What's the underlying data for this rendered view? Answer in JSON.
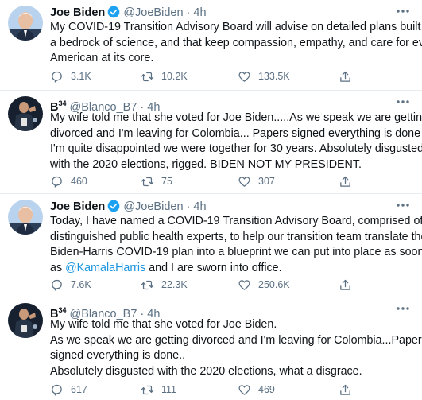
{
  "tweets": [
    {
      "name": "Joe Biden",
      "verified": true,
      "handle": "@JoeBiden",
      "time": "4h",
      "lines": [
        "My COVID-19 Transition Advisory Board will advise on detailed plans built on",
        "a bedrock of science, and that keep compassion, empathy, and care for every",
        "American at its core."
      ],
      "replies": "3.1K",
      "retweets": "10.2K",
      "likes": "133.5K"
    },
    {
      "name": "B",
      "name_sup": "34",
      "verified": false,
      "handle": "@Blanco_B7",
      "time": "4h",
      "lines": [
        "My wife told me that she voted for Joe Biden.....As we speak we are getting",
        "divorced and I'm leaving for Colombia... Papers signed everything is done",
        "I'm quite disappointed we were together for 30 years. Absolutely disgusted",
        "with the 2020 elections, rigged. BIDEN NOT MY PRESIDENT."
      ],
      "replies": "460",
      "retweets": "75",
      "likes": "307"
    },
    {
      "name": "Joe Biden",
      "verified": true,
      "handle": "@JoeBiden",
      "time": "4h",
      "lines": [
        "Today, I have named a COVID-19 Transition Advisory Board, comprised of",
        "distinguished public health experts, to help our transition team translate the",
        "Biden-Harris COVID-19 plan into a blueprint we can put into place as soon"
      ],
      "line4_before": "as ",
      "line4_mention": "@KamalaHarris",
      "line4_after": " and I are sworn into office.",
      "replies": "7.6K",
      "retweets": "22.3K",
      "likes": "250.6K"
    },
    {
      "name": "B",
      "name_sup": "34",
      "verified": false,
      "handle": "@Blanco_B7",
      "time": "4h",
      "lines": [
        "My wife told me that she voted for Joe Biden.",
        "As we speak we are getting divorced and I'm leaving for Colombia...Papers",
        "signed everything is done..",
        "Absolutely disgusted with the 2020 elections, what a disgrace."
      ],
      "replies": "617",
      "retweets": "111",
      "likes": "469"
    }
  ],
  "separator": "·",
  "colors": {
    "text": "#0f1419",
    "secondary": "#5b7083",
    "link": "#1b95e0",
    "verified": "#1da1f2",
    "divider": "#e6ecf0"
  },
  "icons": [
    "verified-badge-icon",
    "more-icon",
    "reply-icon",
    "retweet-icon",
    "like-icon",
    "share-icon"
  ]
}
